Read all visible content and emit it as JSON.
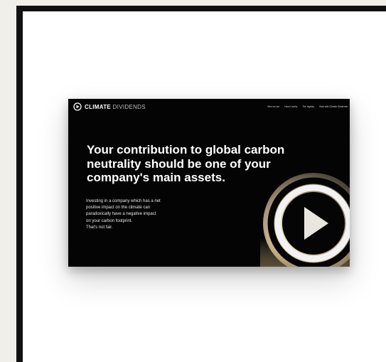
{
  "logo": {
    "brand_bold": "CLIMATE",
    "brand_light": "DIVIDENDS",
    "icon": "play-circle-logo-icon"
  },
  "nav": {
    "links": [
      "Who we are",
      "How it works",
      "The registry",
      "Start with Climate Dividends"
    ]
  },
  "hero": {
    "headline": "Your contribution to global carbon neutrality should be one of your company's main assets.",
    "body_lines": [
      "Investing in a company which has a net",
      "positive impact on the climate can",
      "paradoxically have a negative impact",
      "on your carbon footprint.",
      "That's not fair."
    ],
    "graphic_icon": "play-ring-graphic"
  },
  "colors": {
    "page_background": "#f0efe9",
    "frame": "#111111",
    "card_background": "#040404",
    "text": "#ffffff"
  }
}
